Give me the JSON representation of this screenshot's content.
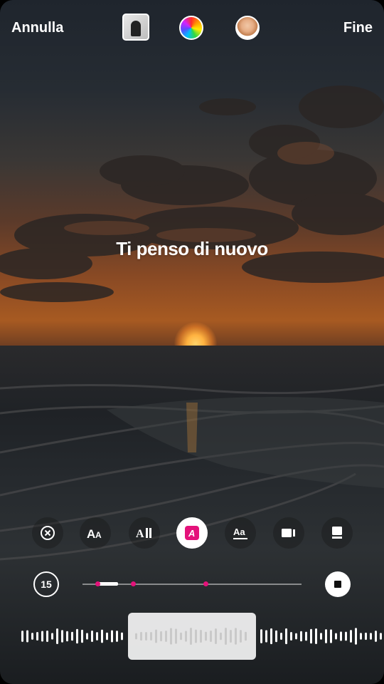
{
  "header": {
    "cancel_label": "Annulla",
    "done_label": "Fine",
    "music_thumbnail_icon": "album-art",
    "color_picker_icon": "color-wheel-icon",
    "profile_icon": "avatar"
  },
  "lyric": {
    "text": "Ti penso di nuovo"
  },
  "style_toolbar": {
    "items": [
      {
        "icon": "clear-icon"
      },
      {
        "icon": "text-size-icon"
      },
      {
        "icon": "typewriter-icon"
      },
      {
        "icon": "highlight-style-icon",
        "active": true
      },
      {
        "icon": "underline-text-icon"
      },
      {
        "icon": "video-card-icon"
      },
      {
        "icon": "album-card-icon"
      }
    ],
    "accent_color": "#e4127a"
  },
  "playback": {
    "duration_label": "15",
    "stop_icon": "stop-icon"
  }
}
